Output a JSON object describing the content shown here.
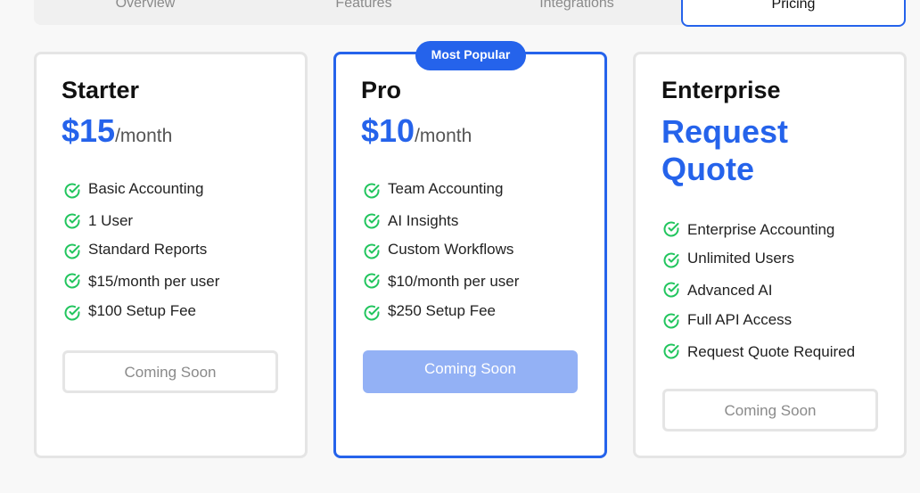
{
  "tabs": [
    {
      "label": "Overview"
    },
    {
      "label": "Features"
    },
    {
      "label": "Integrations"
    },
    {
      "label": "Pricing"
    }
  ],
  "plans": [
    {
      "name": "Starter",
      "price_amount": "$15",
      "price_period": "/month",
      "features": [
        "Basic Accounting",
        "1 User",
        "Standard Reports",
        "$15/month per user",
        "$100 Setup Fee"
      ],
      "button_label": "Coming Soon"
    },
    {
      "name": "Pro",
      "badge": "Most Popular",
      "price_amount": "$10",
      "price_period": "/month",
      "features": [
        "Team Accounting",
        "AI Insights",
        "Custom Workflows",
        "$10/month per user",
        "$250 Setup Fee"
      ],
      "button_label": "Coming Soon"
    },
    {
      "name": "Enterprise",
      "quote_line1": "Request",
      "quote_line2": "Quote",
      "features": [
        "Enterprise Accounting",
        "Unlimited Users",
        "Advanced AI",
        "Full API Access",
        "Request Quote Required"
      ],
      "button_label": "Coming Soon"
    }
  ],
  "colors": {
    "accent": "#2563eb",
    "check": "#22c55e",
    "button_disabled_fill": "#93b1f5"
  },
  "icons": {
    "feature_check": "check-circle-icon"
  }
}
